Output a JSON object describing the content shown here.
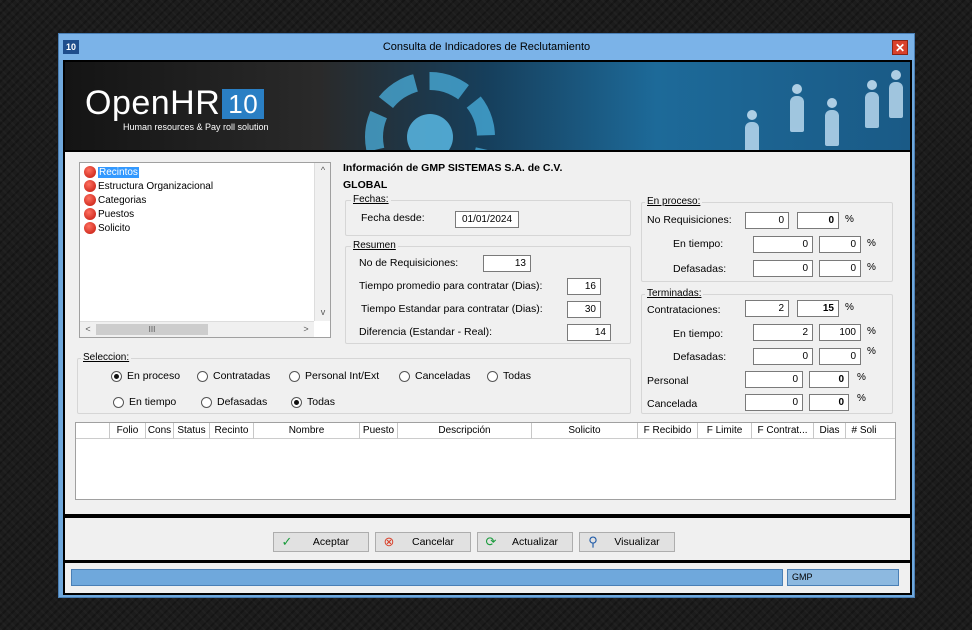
{
  "window": {
    "icon_text": "10",
    "title": "Consulta de Indicadores de Reclutamiento",
    "close_glyph": "✕"
  },
  "banner": {
    "logo": "OpenHR",
    "version": "10",
    "tagline": "Human resources & Pay roll solution"
  },
  "tree": {
    "items": [
      {
        "label": "Recintos",
        "selected": true
      },
      {
        "label": "Estructura Organizacional"
      },
      {
        "label": "Categorias"
      },
      {
        "label": "Puestos"
      },
      {
        "label": "Solicito"
      }
    ],
    "scroll_up": "^",
    "scroll_down": "v",
    "scroll_left": "<",
    "scroll_right": ">",
    "thumb_grip": "III"
  },
  "info": {
    "company": "Información de GMP SISTEMAS S.A. de C.V.",
    "scope": "GLOBAL"
  },
  "fechas": {
    "title": "Fechas:",
    "desde_label": "Fecha desde:",
    "desde_value": "01/01/2024"
  },
  "resumen": {
    "title": "Resumen",
    "rows": [
      {
        "label": "No de Requisiciones:",
        "value": "13"
      },
      {
        "label": "Tiempo promedio para contratar (Dias):",
        "value": "16"
      },
      {
        "label": "Tiempo Estandar para contratar (Dias):",
        "value": "30"
      },
      {
        "label": "Diferencia (Estandar - Real):",
        "value": "14"
      }
    ]
  },
  "en_proceso": {
    "title": "En proceso:",
    "rows": [
      {
        "label": "No Requisiciones:",
        "value": "0",
        "pct": "0",
        "pct_sign": "%"
      },
      {
        "label": "En tiempo:",
        "value": "0",
        "pct": "0",
        "pct_sign": "%"
      },
      {
        "label": "Defasadas:",
        "value": "0",
        "pct": "0",
        "pct_sign": "%"
      }
    ]
  },
  "terminadas": {
    "title": "Terminadas:",
    "rows": [
      {
        "label": "Contrataciones:",
        "value": "2",
        "pct": "15",
        "pct_sign": "%"
      },
      {
        "label": "En tiempo:",
        "value": "2",
        "pct": "100",
        "pct_sign": "%"
      },
      {
        "label": "Defasadas:",
        "value": "0",
        "pct": "0",
        "pct_sign": "%"
      },
      {
        "label": "Personal",
        "value": "0",
        "pct": "0",
        "pct_sign": "%"
      },
      {
        "label": "Cancelada",
        "value": "0",
        "pct": "0",
        "pct_sign": "%"
      }
    ]
  },
  "seleccion": {
    "title": "Seleccion:",
    "row1": [
      {
        "label": "En proceso",
        "checked": true
      },
      {
        "label": "Contratadas",
        "checked": false
      },
      {
        "label": "Personal Int/Ext",
        "checked": false
      },
      {
        "label": "Canceladas",
        "checked": false
      },
      {
        "label": "Todas",
        "checked": false
      }
    ],
    "row2": [
      {
        "label": "En tiempo",
        "checked": false
      },
      {
        "label": "Defasadas",
        "checked": false
      },
      {
        "label": "Todas",
        "checked": true
      }
    ]
  },
  "grid": {
    "columns": [
      "",
      "Folio",
      "Cons",
      "Status",
      "Recinto",
      "Nombre",
      "Puesto",
      "Descripción",
      "Solicito",
      "F Recibido",
      "F Limite",
      "F Contrat...",
      "Dias",
      "# Soli"
    ]
  },
  "buttons": {
    "aceptar": "Aceptar",
    "cancelar": "Cancelar",
    "actualizar": "Actualizar",
    "visualizar": "Visualizar"
  },
  "status": {
    "user": "GMP"
  },
  "colors": {
    "window_frame": "#6fa8dc",
    "accept_icon": "#1a9b3c",
    "cancel_icon": "#d9412b",
    "refresh_icon": "#1a9b3c",
    "view_icon": "#1e5aa8"
  }
}
